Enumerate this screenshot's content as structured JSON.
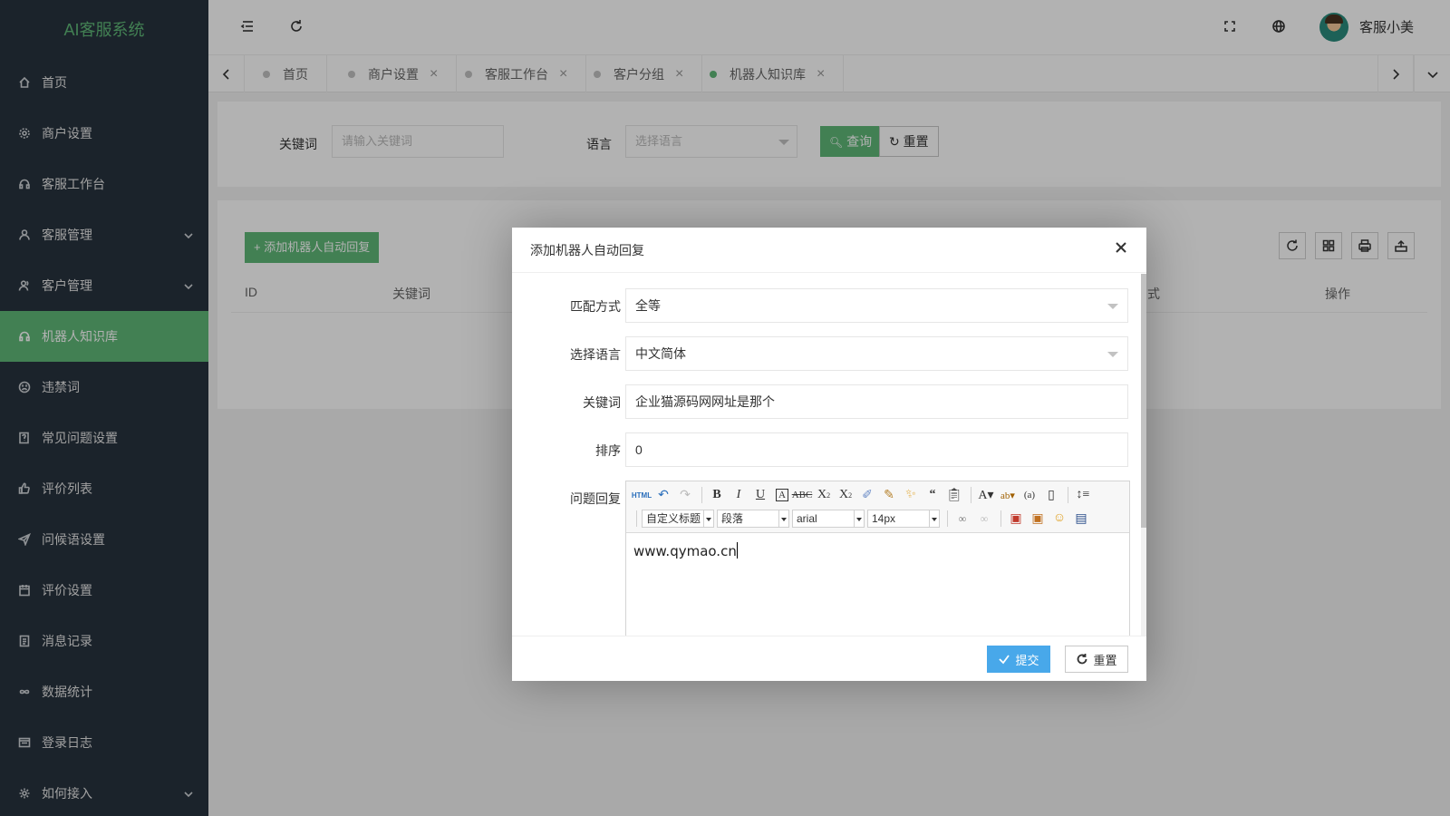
{
  "app": {
    "title": "AI客服系统"
  },
  "sidebar": {
    "items": [
      {
        "label": "首页",
        "icon": "home-icon"
      },
      {
        "label": "商户设置",
        "icon": "gear-icon"
      },
      {
        "label": "客服工作台",
        "icon": "headset-icon"
      },
      {
        "label": "客服管理",
        "icon": "user-icon",
        "expandable": true
      },
      {
        "label": "客户管理",
        "icon": "users-icon",
        "expandable": true
      },
      {
        "label": "机器人知识库",
        "icon": "robot-icon",
        "active": true
      },
      {
        "label": "违禁词",
        "icon": "frown-icon"
      },
      {
        "label": "常见问题设置",
        "icon": "faq-icon"
      },
      {
        "label": "评价列表",
        "icon": "thumb-up-icon"
      },
      {
        "label": "问候语设置",
        "icon": "send-icon"
      },
      {
        "label": "评价设置",
        "icon": "calendar-icon"
      },
      {
        "label": "消息记录",
        "icon": "list-icon"
      },
      {
        "label": "数据统计",
        "icon": "infinity-icon"
      },
      {
        "label": "登录日志",
        "icon": "log-icon"
      },
      {
        "label": "如何接入",
        "icon": "plug-icon",
        "expandable": true
      }
    ]
  },
  "header": {
    "username": "客服小美"
  },
  "tabs": [
    {
      "label": "首页",
      "closable": false
    },
    {
      "label": "商户设置",
      "closable": true
    },
    {
      "label": "客服工作台",
      "closable": true
    },
    {
      "label": "客户分组",
      "closable": true
    },
    {
      "label": "机器人知识库",
      "closable": true,
      "active": true
    }
  ],
  "search": {
    "keyword_label": "关键词",
    "keyword_placeholder": "请输入关键词",
    "language_label": "语言",
    "language_placeholder": "选择语言",
    "query_button": "查询",
    "reset_button": "重置"
  },
  "table": {
    "add_button": "+ 添加机器人自动回复",
    "columns": [
      "ID",
      "关键词",
      "式",
      "操作"
    ]
  },
  "modal": {
    "title": "添加机器人自动回复",
    "fields": {
      "match_label": "匹配方式",
      "match_value": "全等",
      "language_label": "选择语言",
      "language_value": "中文简体",
      "keyword_label": "关键词",
      "keyword_value": "企业猫源码网网址是那个",
      "sort_label": "排序",
      "sort_value": "0",
      "reply_label": "问题回复"
    },
    "editor": {
      "html_label": "HTML",
      "heading_select": "自定义标题",
      "paragraph_select": "段落",
      "font_select": "arial",
      "size_select": "14px",
      "content": "www.qymao.cn"
    },
    "submit_button": "提交",
    "reset_button": "重置"
  },
  "colors": {
    "accent": "#5fb878",
    "sidebar_bg": "#28333e",
    "primary_blue": "#48a8ea"
  }
}
